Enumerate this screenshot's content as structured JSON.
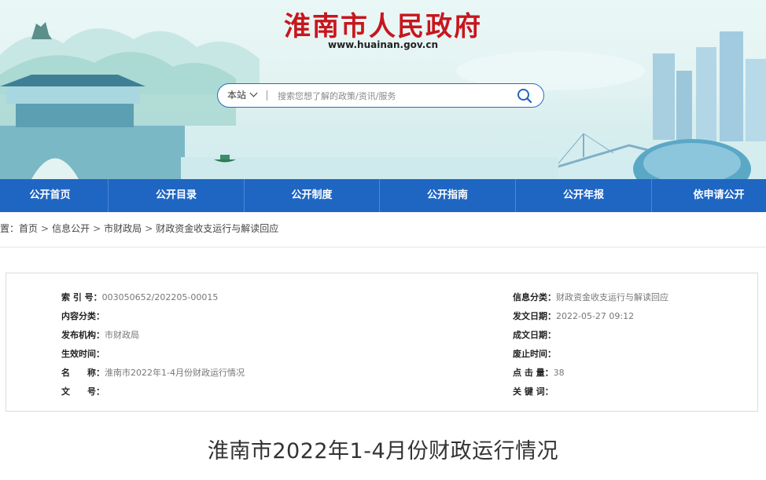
{
  "header": {
    "site_title": "淮南市人民政府",
    "site_url": "www.huainan.gov.cn",
    "title_color": "#c8161d"
  },
  "search": {
    "scope_label": "本站",
    "placeholder": "搜索您想了解的政策/资讯/服务",
    "icon": "search-icon"
  },
  "nav": {
    "color": "#1f66c2",
    "items": [
      {
        "label": "公开首页"
      },
      {
        "label": "公开目录"
      },
      {
        "label": "公开制度"
      },
      {
        "label": "公开指南"
      },
      {
        "label": "公开年报"
      },
      {
        "label": "依申请公开"
      }
    ]
  },
  "breadcrumb": {
    "prefix": "位置：",
    "items": [
      "首页",
      "信息公开",
      "市财政局",
      "财政资金收支运行与解读回应"
    ],
    "separator": ">"
  },
  "info": {
    "left": [
      {
        "key": "索 引 号：",
        "value": "003050652/202205-00015"
      },
      {
        "key": "内容分类：",
        "value": ""
      },
      {
        "key": "发布机构：",
        "value": "市财政局"
      },
      {
        "key": "生效时间：",
        "value": ""
      },
      {
        "key": "名　　称：",
        "value": "淮南市2022年1-4月份财政运行情况"
      },
      {
        "key": "文　　号：",
        "value": ""
      }
    ],
    "right": [
      {
        "key": "信息分类：",
        "value": "财政资金收支运行与解读回应"
      },
      {
        "key": "发文日期：",
        "value": "2022-05-27 09:12"
      },
      {
        "key": "成文日期：",
        "value": ""
      },
      {
        "key": "废止时间：",
        "value": ""
      },
      {
        "key": "点 击 量：",
        "value": "38"
      },
      {
        "key": "关 键 词：",
        "value": ""
      }
    ]
  },
  "article": {
    "title": "淮南市2022年1-4月份财政运行情况"
  }
}
